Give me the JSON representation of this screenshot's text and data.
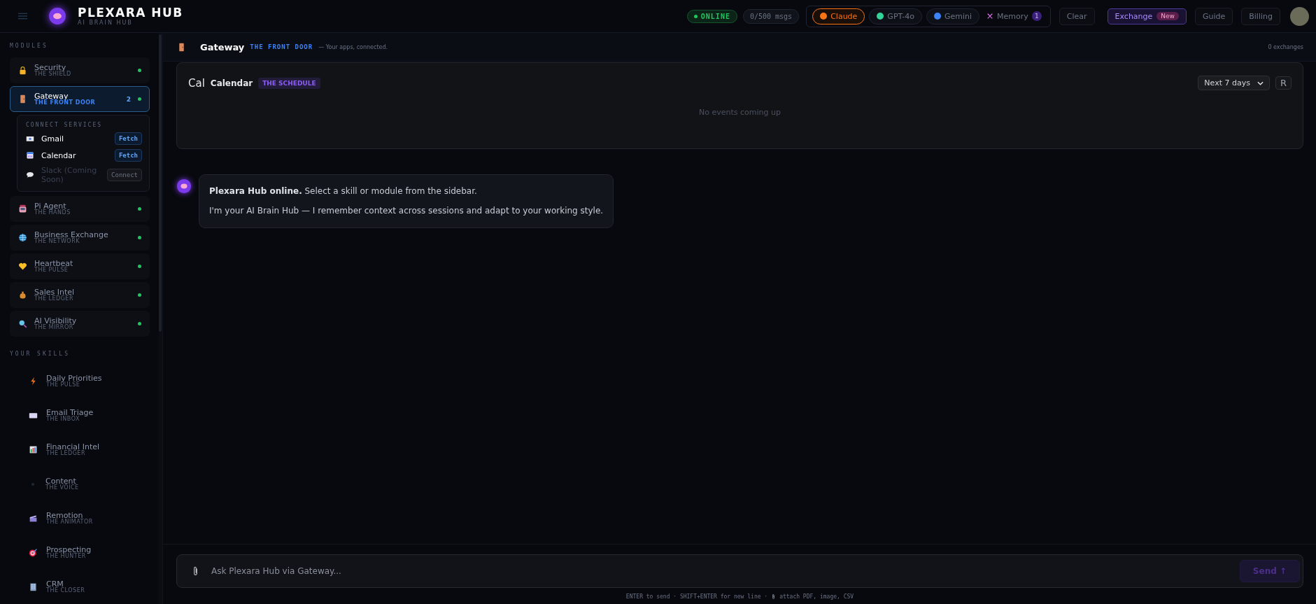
{
  "brand": {
    "title": "PLEXARA HUB",
    "subtitle": "AI BRAIN HUB"
  },
  "status": {
    "label": "ONLINE",
    "online": true
  },
  "usage": "0/500 msgs",
  "models": [
    {
      "label": "Claude",
      "color": "#f97316",
      "selected": true
    },
    {
      "label": "GPT-4o",
      "color": "#34d399",
      "selected": false
    },
    {
      "label": "Gemini",
      "color": "#3b82f6",
      "selected": false
    }
  ],
  "memory": {
    "label": "Memory",
    "count": "1"
  },
  "actions": [
    {
      "label": "Clear",
      "kind": "plain"
    },
    {
      "label": "Exchange",
      "kind": "highlight",
      "badge": "New"
    },
    {
      "label": "Guide",
      "kind": "plain"
    },
    {
      "label": "Billing",
      "kind": "plain"
    }
  ],
  "sidebar": {
    "modules_heading": "MODULES",
    "modules": [
      {
        "name": "Security",
        "tagline": "THE SHIELD",
        "kind": "lock",
        "selected": false,
        "online": true
      },
      {
        "name": "Gateway",
        "tagline": "THE FRONT DOOR",
        "kind": "door",
        "selected": true,
        "online": true,
        "count": "2",
        "services_heading": "CONNECT SERVICES",
        "services": [
          {
            "name": "Gmail",
            "kind": "mail",
            "action": "Fetch",
            "available": true
          },
          {
            "name": "Calendar",
            "kind": "calendar",
            "action": "Fetch",
            "available": true
          },
          {
            "name": "Slack (Coming Soon)",
            "kind": "bubble",
            "action": "Connect",
            "available": false
          }
        ]
      },
      {
        "name": "Pi Agent",
        "tagline": "THE HANDS",
        "kind": "robot",
        "selected": false,
        "online": true
      },
      {
        "name": "Business Exchange",
        "tagline": "THE NETWORK",
        "kind": "globe",
        "selected": false,
        "online": true
      },
      {
        "name": "Heartbeat",
        "tagline": "THE PULSE",
        "kind": "heart",
        "selected": false,
        "online": true
      },
      {
        "name": "Sales Intel",
        "tagline": "THE LEDGER",
        "kind": "moneybag",
        "selected": false,
        "online": true
      },
      {
        "name": "AI Visibility",
        "tagline": "THE MIRROR",
        "kind": "magnifier",
        "selected": false,
        "online": true
      }
    ],
    "skills_heading": "YOUR SKILLS",
    "skills": [
      {
        "name": "Daily Priorities",
        "tagline": "THE PULSE",
        "kind": "bolt"
      },
      {
        "name": "Email Triage",
        "tagline": "THE INBOX",
        "kind": "envelope"
      },
      {
        "name": "Financial Intel",
        "tagline": "THE LEDGER",
        "kind": "chart"
      },
      {
        "name": "Content",
        "tagline": "THE VOICE",
        "kind": "dot"
      },
      {
        "name": "Remotion",
        "tagline": "THE ANIMATOR",
        "kind": "clapper"
      },
      {
        "name": "Prospecting",
        "tagline": "THE HUNTER",
        "kind": "target"
      },
      {
        "name": "CRM",
        "tagline": "THE CLOSER",
        "kind": "building"
      }
    ]
  },
  "header": {
    "title": "Gateway",
    "tagline": "THE FRONT DOOR",
    "description": "— Your apps, connected.",
    "exchanges": "0 exchanges"
  },
  "calendar": {
    "prefix": "Cal",
    "title": "Calendar",
    "badge": "THE SCHEDULE",
    "range": "Next 7 days",
    "refresh": "R",
    "empty": "No events coming up"
  },
  "messages": [
    {
      "paragraphs": [
        "**Plexara Hub online.** Select a skill or module from the sidebar.",
        "I'm your AI Brain Hub — I remember context across sessions and adapt to your working style."
      ]
    }
  ],
  "composer": {
    "placeholder": "Ask Plexara Hub via Gateway...",
    "send": "Send ↑"
  },
  "hint": {
    "before": "ENTER to send · SHIFT+ENTER for new line ·",
    "after": "attach PDF, image, CSV"
  }
}
